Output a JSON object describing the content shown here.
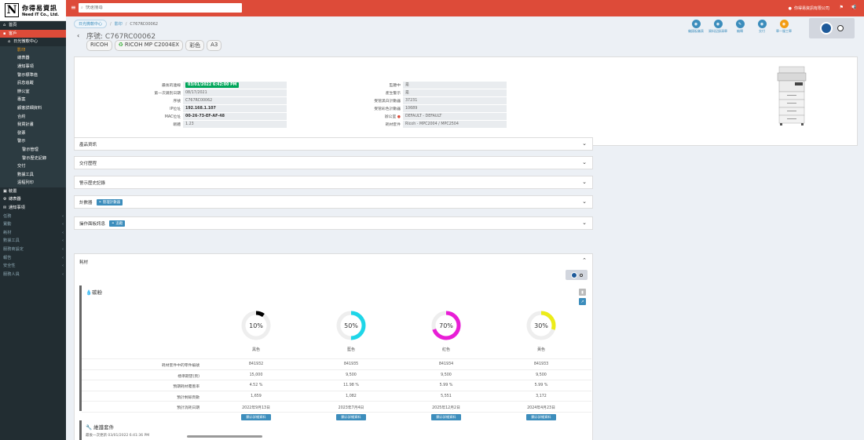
{
  "logo": {
    "letter": "N",
    "zh": "你得易資訊",
    "en": "Need IT Co., Ltd."
  },
  "sidebar": {
    "items": [
      {
        "label": "首頁",
        "icon": "⌂",
        "cls": "top"
      },
      {
        "label": "客戶",
        "icon": "▪",
        "cls": "top active"
      },
      {
        "label": "日光微軟中心",
        "icon": "⌂",
        "cls": "lvl1"
      },
      {
        "label": "影印",
        "icon": "",
        "cls": "lvl2 current"
      },
      {
        "label": "總表器",
        "icon": "",
        "cls": "lvl2"
      },
      {
        "label": "通知事項",
        "icon": "",
        "cls": "lvl2"
      },
      {
        "label": "警示標準值",
        "icon": "",
        "cls": "lvl2"
      },
      {
        "label": "訊息追蹤",
        "icon": "",
        "cls": "lvl2"
      },
      {
        "label": "辦公室",
        "icon": "",
        "cls": "lvl2"
      },
      {
        "label": "專案",
        "icon": "",
        "cls": "lvl2"
      },
      {
        "label": "顧客詳細資料",
        "icon": "",
        "cls": "lvl2"
      },
      {
        "label": "合約",
        "icon": "",
        "cls": "lvl2"
      },
      {
        "label": "我買計畫",
        "icon": "",
        "cls": "lvl2"
      },
      {
        "label": "發票",
        "icon": "",
        "cls": "lvl2"
      },
      {
        "label": "警示",
        "icon": "",
        "cls": "lvl2"
      },
      {
        "label": "警示管理",
        "icon": "",
        "cls": "lvl3"
      },
      {
        "label": "警示歷史記錄",
        "icon": "",
        "cls": "lvl3"
      },
      {
        "label": "交付",
        "icon": "",
        "cls": "lvl2"
      },
      {
        "label": "數據工具",
        "icon": "",
        "cls": "lvl2"
      },
      {
        "label": "遠程列印",
        "icon": "",
        "cls": "lvl2"
      },
      {
        "label": "裝置",
        "icon": "▣",
        "cls": "top"
      },
      {
        "label": "總表器",
        "icon": "⚙",
        "cls": "top"
      },
      {
        "label": "通知事項",
        "icon": "✉",
        "cls": "top"
      },
      {
        "label": "任務",
        "icon": "",
        "cls": "muted",
        "chev": "‹"
      },
      {
        "label": "實動",
        "icon": "",
        "cls": "muted",
        "chev": "‹"
      },
      {
        "label": "耗材",
        "icon": "",
        "cls": "muted",
        "chev": "‹"
      },
      {
        "label": "數據工具",
        "icon": "",
        "cls": "muted",
        "chev": "‹"
      },
      {
        "label": "服務商設定",
        "icon": "",
        "cls": "muted",
        "chev": "‹"
      },
      {
        "label": "報告",
        "icon": "",
        "cls": "muted",
        "chev": "‹"
      },
      {
        "label": "安全性",
        "icon": "",
        "cls": "muted",
        "chev": "‹"
      },
      {
        "label": "服務人員",
        "icon": "",
        "cls": "muted",
        "chev": "‹"
      }
    ]
  },
  "header": {
    "search_placeholder": "快速搜尋",
    "user_name": "你得易資訊有限公司"
  },
  "breadcrumb": {
    "customer": "日光微軟中心",
    "section": "影印",
    "current": "C767RC00062"
  },
  "device": {
    "serial": "序號: C767RC00062",
    "tags": [
      "RICOH",
      "RICOH MP C2004EX",
      "彩色",
      "A3"
    ]
  },
  "toolbar": [
    {
      "label": "儀錶板儀表",
      "icon": "◉"
    },
    {
      "label": "資料記錄清單",
      "icon": "◉"
    },
    {
      "label": "編輯",
      "icon": "✎"
    },
    {
      "label": "交付",
      "icon": "◉"
    },
    {
      "label": "單一服工單",
      "icon": "◉",
      "orange": true
    }
  ],
  "info_left": [
    {
      "k": "最後的連線",
      "v": "03/01/2022 6:42:00 PM",
      "badge": true
    },
    {
      "k": "第一次識別日期",
      "v": "08/17/2021"
    },
    {
      "k": "序號",
      "v": "C767RC00062"
    },
    {
      "k": "IP位址",
      "v": "192.168.1.107",
      "bold": true
    },
    {
      "k": "MAC位址",
      "v": "00-26-73-EF-AF-48",
      "bold": true
    },
    {
      "k": "韌體",
      "v": "1.23"
    }
  ],
  "info_right": [
    {
      "k": "監聽中",
      "v": "是"
    },
    {
      "k": "產生警示",
      "v": "是"
    },
    {
      "k": "受管黑白計數器",
      "v": "37231"
    },
    {
      "k": "受管彩色計數器",
      "v": "10689"
    },
    {
      "k": "辦公室",
      "v": "DEFAULT - DEFAULT",
      "warn": true
    },
    {
      "k": "耗材套件",
      "v": "Ricoh - MPC2004 / MPC2504"
    }
  ],
  "sections": [
    {
      "label": "產品資訊",
      "badge": ""
    },
    {
      "label": "交付歷程",
      "badge": ""
    },
    {
      "label": "警示歷史記錄",
      "badge": ""
    },
    {
      "label": "計數器",
      "badge": "管理計數器"
    },
    {
      "label": "操作面板訊息",
      "badge": "追蹤"
    }
  ],
  "consumables": {
    "title": "耗材",
    "toner_title": "碳粉",
    "toners": [
      {
        "name": "黑色",
        "percent": 10,
        "label": "10%",
        "color": "#000000"
      },
      {
        "name": "藍色",
        "percent": 50,
        "label": "50%",
        "color": "#1ed6e8"
      },
      {
        "name": "紅色",
        "percent": 70,
        "label": "70%",
        "color": "#e81ed6"
      },
      {
        "name": "黃色",
        "percent": 30,
        "label": "30%",
        "color": "#ecec18"
      }
    ],
    "rows": [
      {
        "k": "耗材套件中的零件編號",
        "v": [
          "841932",
          "841935",
          "841934",
          "841933"
        ]
      },
      {
        "k": "標準期望(頁)",
        "v": [
          "15,000",
          "9,500",
          "9,500",
          "9,500"
        ]
      },
      {
        "k": "預期耗材覆蓋率",
        "v": [
          "4.52 %",
          "11.98 %",
          "5.99 %",
          "5.99 %"
        ]
      },
      {
        "k": "預計剩餘頁數",
        "v": [
          "1,659",
          "1,082",
          "5,551",
          "3,172"
        ]
      },
      {
        "k": "預計消耗日期",
        "v": [
          "2022年9月13日",
          "2023年7月4日",
          "2025年12月2日",
          "2024年4月23日"
        ]
      }
    ],
    "detail_button": "顯示詳細資料",
    "maint_title": "維護套件",
    "maint_sub": "最後一次更新 03/01/2022 6:41:36 PM"
  }
}
